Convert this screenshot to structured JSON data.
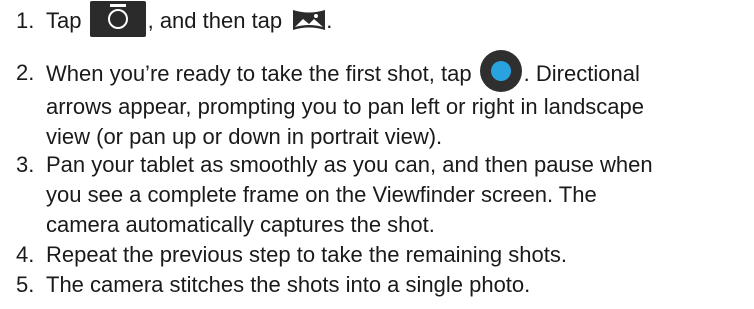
{
  "steps": [
    {
      "number": "1.",
      "parts": {
        "a": "Tap ",
        "b": ", and then tap ",
        "c": "."
      }
    },
    {
      "number": "2.",
      "lines": {
        "l1a": "When you’re ready to take the first shot, tap ",
        "l1b": ". Directional",
        "l2": "arrows appear, prompting you to pan left or right in landscape",
        "l3": "view (or pan up or down in portrait view)."
      }
    },
    {
      "number": "3.",
      "lines": {
        "l1": "Pan your tablet as smoothly as you can, and then pause when",
        "l2": "you see a complete frame on the Viewfinder screen. The",
        "l3": "camera automatically captures the shot."
      }
    },
    {
      "number": "4.",
      "lines": {
        "l1": "Repeat the previous step to take the remaining shots."
      }
    },
    {
      "number": "5.",
      "lines": {
        "l1": "The camera stitches the shots into a single photo."
      }
    }
  ],
  "icons": {
    "camera": "camera-icon",
    "panorama": "panorama-icon",
    "shutter": "shutter-icon",
    "accent_color": "#29a3e0",
    "icon_color": "#2b2b2b"
  }
}
